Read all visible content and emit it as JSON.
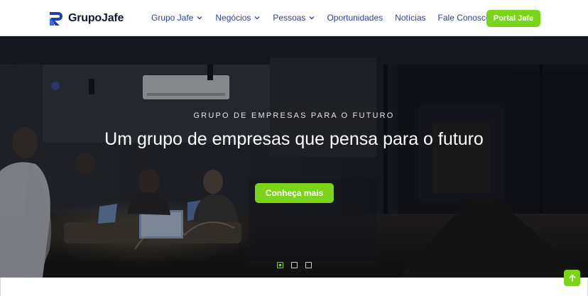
{
  "brand": {
    "name": "GrupoJafe",
    "logo_icon": "grupojafe-logo-icon",
    "primary_color": "#2c3fa8",
    "accent_color": "#7ad417"
  },
  "nav": {
    "items": [
      {
        "label": "Grupo Jafe",
        "dropdown": true
      },
      {
        "label": "Negócios",
        "dropdown": true
      },
      {
        "label": "Pessoas",
        "dropdown": true
      },
      {
        "label": "Oportunidades",
        "dropdown": false
      },
      {
        "label": "Notícias",
        "dropdown": false
      },
      {
        "label": "Fale Conosco",
        "dropdown": false
      }
    ],
    "portal_button": "Portal Jafe"
  },
  "hero": {
    "eyebrow": "GRUPO DE EMPRESAS PARA O FUTURO",
    "headline": "Um grupo de empresas que pensa para o futuro",
    "cta": "Conheça mais",
    "slides": 3,
    "active_slide": 1
  },
  "back_to_top_icon": "arrow-up-icon"
}
